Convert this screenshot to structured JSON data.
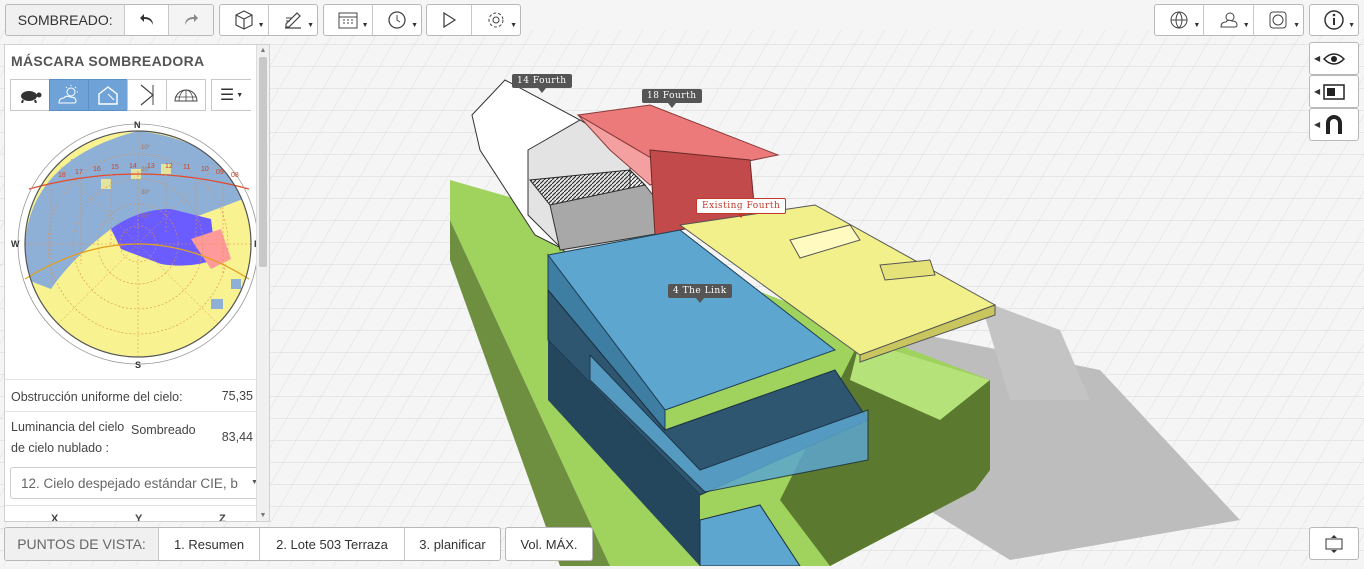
{
  "toolbar": {
    "mode_label": "SOMBREADO:",
    "undo_icon": "undo-arrow-icon",
    "redo_icon": "redo-arrow-icon",
    "tools": [
      "cube-icon",
      "edit-icon",
      "calendar-icon",
      "clock-icon",
      "play-icon",
      "gear-icon"
    ],
    "right_tools": [
      "globe-icon",
      "sky-icon",
      "sundial-icon",
      "info-icon"
    ]
  },
  "side_tools": [
    "eye-icon",
    "panel-icon",
    "magnet-icon"
  ],
  "panel": {
    "title": "MÁSCARA SOMBREADORA",
    "icons": [
      "turtle-icon",
      "sun-cloud-icon",
      "sun-shade-icon",
      "projection-icon",
      "dome-icon",
      "menu-icon"
    ],
    "compass": {
      "n": "N",
      "s": "S",
      "w": "W",
      "e": "E"
    },
    "sun_hours": [
      "18",
      "17",
      "16",
      "15",
      "14",
      "13",
      "12",
      "11",
      "10",
      "09",
      "08"
    ],
    "altitudes": [
      "10°",
      "20°",
      "30°",
      "40°"
    ],
    "rows": [
      {
        "label": "Obstrucción uniforme del cielo:",
        "value": "75,35"
      },
      {
        "label": "Luminancia del cielo",
        "label2": "de cielo nublado :",
        "mid": "Sombreado",
        "value": "83,44"
      }
    ],
    "sky_select": "12. Cielo despejado estándar CIE, b",
    "columns": [
      "X",
      "Y",
      "Z"
    ]
  },
  "viewpoints": {
    "label": "PUNTOS DE VISTA:",
    "items": [
      "1. Resumen",
      "2. Lote 503 Terraza",
      "3. planificar",
      "Vol. MÁX."
    ]
  },
  "scene_tags": [
    "14 Fourth",
    "18 Fourth",
    "Existing Fourth",
    "4 The Link"
  ],
  "colors": {
    "green": "#9fd35e",
    "blue": "#5ca6cf",
    "red": "#ec7a7a",
    "yellow": "#f2f08a",
    "accent": "#6fa3d8"
  }
}
